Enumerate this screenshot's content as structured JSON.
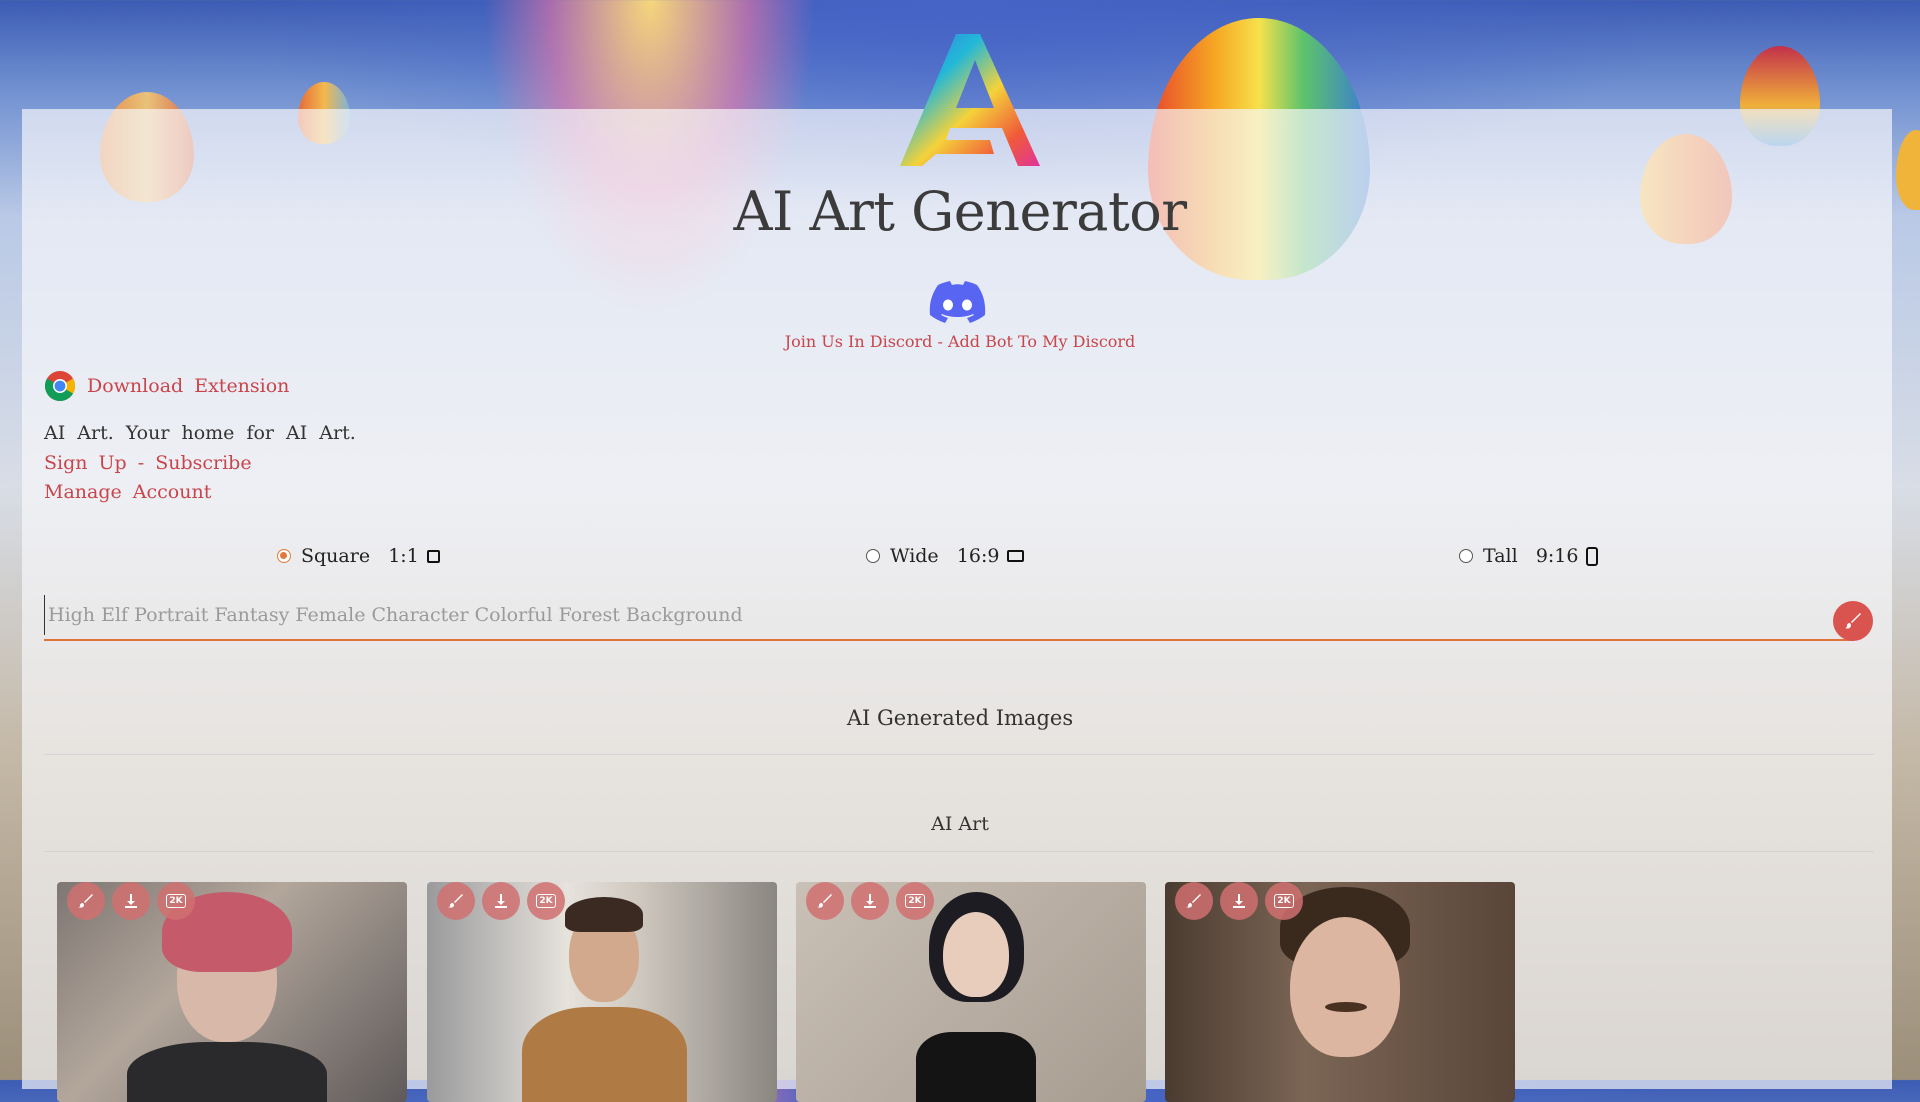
{
  "header": {
    "title": "AI Art Generator",
    "discord_join": "Join Us In Discord",
    "discord_sep": " - ",
    "discord_add_bot": "Add Bot To My Discord"
  },
  "extension": {
    "label": "Download Extension"
  },
  "intro": {
    "tagline": "AI Art. Your home for AI Art.",
    "sign_up": "Sign Up",
    "sep": " - ",
    "subscribe": "Subscribe",
    "manage_account": "Manage Account"
  },
  "aspect": {
    "selected": "square",
    "options": [
      {
        "id": "square",
        "name": "Square",
        "ratio": "1:1",
        "icon": "square-shape-icon"
      },
      {
        "id": "wide",
        "name": "Wide",
        "ratio": "16:9",
        "icon": "wide-shape-icon"
      },
      {
        "id": "tall",
        "name": "Tall",
        "ratio": "9:16",
        "icon": "tall-shape-icon"
      }
    ]
  },
  "prompt": {
    "placeholder": "High Elf Portrait Fantasy Female Character Colorful Forest Background",
    "value": ""
  },
  "gallery": {
    "section_title": "AI Generated Images",
    "subsection_title": "AI Art",
    "tool_icons": [
      "edit-icon",
      "download-icon",
      "2k-upscale-icon"
    ],
    "badge_label": "2K",
    "cards": [
      {
        "subject": "woman with pink hair in leather jacket"
      },
      {
        "subject": "man in tan jacket on city street"
      },
      {
        "subject": "smiling woman in black off-shoulder dress"
      },
      {
        "subject": "man with curly hair and mustache in cafe"
      }
    ]
  },
  "colors": {
    "accent": "#c8454b",
    "underline": "#e0733a",
    "tool_button": "#d07070"
  }
}
